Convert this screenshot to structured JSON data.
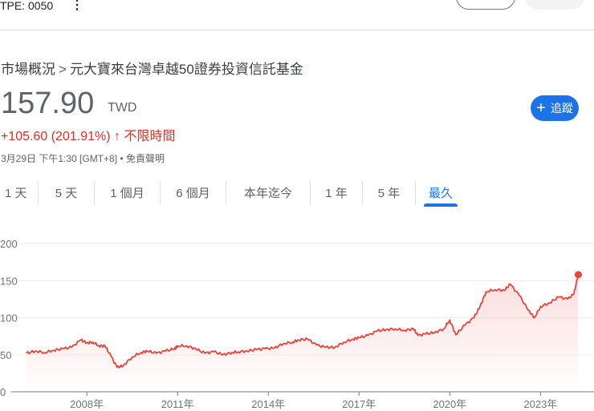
{
  "header": {
    "ticker": "TPE: 0050",
    "more_icon": "more-vert-icon"
  },
  "breadcrumb": {
    "root": "市場概況",
    "separator": ">",
    "name": "元大寶來台灣卓越50證券投資信託基金"
  },
  "quote": {
    "price": "157.90",
    "currency": "TWD",
    "change": "+105.60 (201.91%)",
    "arrow": "↑",
    "period": "不限時間",
    "timestamp": "3月29日 下午1:30 [GMT+8] • ",
    "disclaimer": "免責聲明"
  },
  "follow_button": {
    "icon": "+",
    "label": "追蹤"
  },
  "tabs": [
    {
      "label": "1 天"
    },
    {
      "label": "5 天"
    },
    {
      "label": "1 個月"
    },
    {
      "label": "6 個月"
    },
    {
      "label": "本年迄今"
    },
    {
      "label": "1 年"
    },
    {
      "label": "5 年"
    },
    {
      "label": "最久",
      "active": true
    }
  ],
  "colors": {
    "line": "#e8453c",
    "accent": "#1a73e8",
    "negative_text": "#d93025"
  },
  "chart_data": {
    "type": "line",
    "title": "",
    "xlabel": "",
    "ylabel": "",
    "ylim": [
      0,
      200
    ],
    "xlim": [
      2005.9,
      2024.45
    ],
    "yticks": [
      "0",
      "50",
      "100",
      "150",
      "200"
    ],
    "ytick_values": [
      0,
      50,
      100,
      150,
      200
    ],
    "xticks": [
      "2008年",
      "2011年",
      "2014年",
      "2017年",
      "2020年",
      "2023年"
    ],
    "xtick_values": [
      2008,
      2011,
      2014,
      2017,
      2020,
      2023
    ],
    "grid": true,
    "series": [
      {
        "name": "0050",
        "x": [
          2006.0,
          2006.3,
          2006.6,
          2006.9,
          2007.2,
          2007.5,
          2007.8,
          2008.0,
          2008.2,
          2008.4,
          2008.6,
          2008.8,
          2009.0,
          2009.2,
          2009.5,
          2009.8,
          2010.0,
          2010.3,
          2010.6,
          2010.9,
          2011.0,
          2011.3,
          2011.6,
          2011.9,
          2012.2,
          2012.5,
          2012.8,
          2013.0,
          2013.3,
          2013.6,
          2013.9,
          2014.2,
          2014.5,
          2014.8,
          2015.0,
          2015.3,
          2015.6,
          2015.9,
          2016.2,
          2016.5,
          2016.8,
          2017.0,
          2017.3,
          2017.6,
          2017.9,
          2018.2,
          2018.5,
          2018.8,
          2018.95,
          2019.2,
          2019.5,
          2019.8,
          2020.0,
          2020.2,
          2020.5,
          2020.8,
          2021.0,
          2021.2,
          2021.5,
          2021.8,
          2022.0,
          2022.3,
          2022.6,
          2022.8,
          2023.0,
          2023.3,
          2023.6,
          2023.9,
          2024.1,
          2024.25
        ],
        "y": [
          52,
          55,
          53,
          56,
          58,
          60,
          70,
          66,
          67,
          62,
          62,
          48,
          33,
          35,
          47,
          53,
          55,
          52,
          55,
          58,
          62,
          62,
          58,
          52,
          54,
          50,
          53,
          54,
          55,
          57,
          58,
          59,
          65,
          67,
          70,
          71,
          63,
          60,
          60,
          67,
          71,
          73,
          76,
          82,
          84,
          85,
          83,
          85,
          76,
          78,
          80,
          85,
          97,
          77,
          90,
          100,
          115,
          135,
          138,
          137,
          145,
          130,
          110,
          100,
          115,
          120,
          128,
          125,
          132,
          158
        ]
      }
    ]
  }
}
